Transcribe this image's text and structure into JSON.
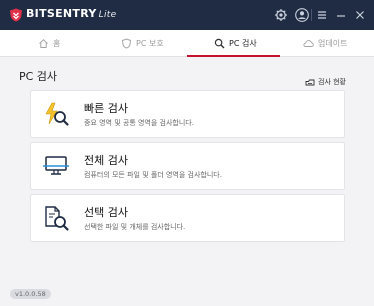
{
  "app": {
    "brand_name": "BITSENTRY",
    "brand_suffix": "Lite",
    "accent_color": "#c4122f",
    "titlebar_color": "#1f2c44"
  },
  "titlebar": {
    "icons": [
      "settings-icon",
      "account-icon",
      "menu-icon",
      "minimize-icon",
      "close-icon"
    ]
  },
  "nav": {
    "tabs": [
      {
        "label": "홈",
        "icon": "home-icon",
        "active": false
      },
      {
        "label": "PC 보호",
        "icon": "shield-icon",
        "active": false
      },
      {
        "label": "PC 검사",
        "icon": "scan-icon",
        "active": true
      },
      {
        "label": "업데이트",
        "icon": "cloud-icon",
        "active": false
      }
    ]
  },
  "main": {
    "title": "PC 검사",
    "status_link": "검사 현황"
  },
  "scan_options": [
    {
      "title": "빠른 검사",
      "description": "중요 영역 및 공통 영역을 검사합니다.",
      "icon": "quick-scan-icon"
    },
    {
      "title": "전체 검사",
      "description": "컴퓨터의 모든 파일 및 폴더 영역을 검사합니다.",
      "icon": "full-scan-icon"
    },
    {
      "title": "선택 검사",
      "description": "선택한 파일 및 개체를 검사합니다.",
      "icon": "custom-scan-icon"
    }
  ],
  "footer": {
    "version": "v1.0.0.58"
  }
}
